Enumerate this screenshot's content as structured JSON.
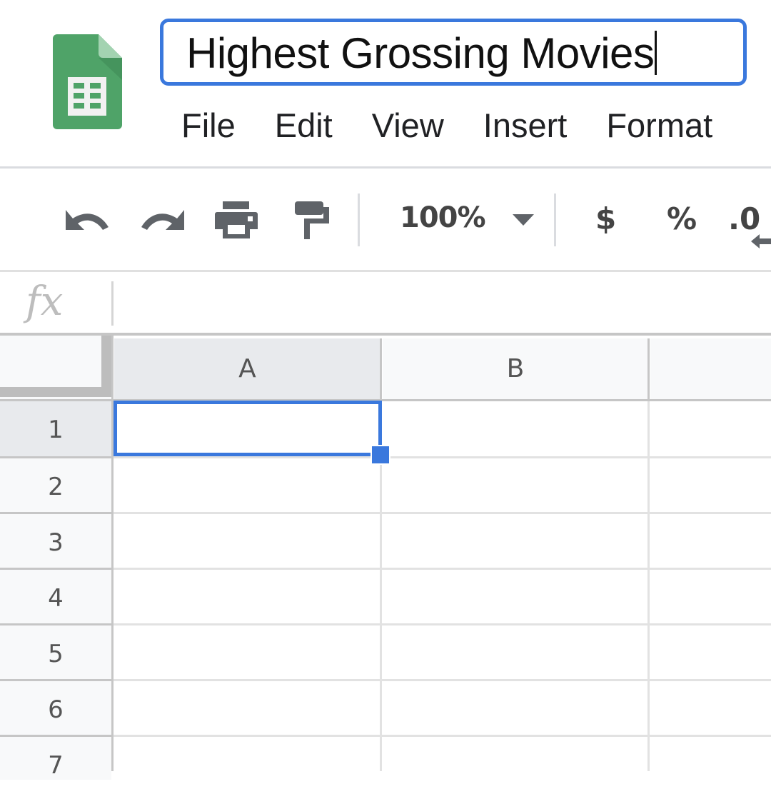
{
  "app": {
    "name": "Google Sheets",
    "logo_icon": "sheets-logo-icon",
    "brand_colors": {
      "green": "#34a853",
      "accent_blue": "#3a78dd"
    }
  },
  "header": {
    "document_title": "Highest Grossing Movies",
    "menu": [
      {
        "label": "File"
      },
      {
        "label": "Edit"
      },
      {
        "label": "View"
      },
      {
        "label": "Insert"
      },
      {
        "label": "Format"
      }
    ]
  },
  "toolbar": {
    "undo_icon": "undo-icon",
    "redo_icon": "redo-icon",
    "print_icon": "print-icon",
    "paint_format_icon": "paint-format-icon",
    "zoom": "100%",
    "zoom_dropdown_icon": "caret-down-icon",
    "currency_label": "$",
    "percent_label": "%",
    "decrease_decimal_label": ".0",
    "decrease_decimal_icon": "arrow-left-icon"
  },
  "formula_bar": {
    "fx_label": "fx",
    "value": ""
  },
  "grid": {
    "columns": [
      "A",
      "B"
    ],
    "rows": [
      "1",
      "2",
      "3",
      "4",
      "5",
      "6",
      "7"
    ],
    "selected_cell": "A1",
    "cells": {
      "A1": "",
      "B1": "",
      "A2": "",
      "B2": "",
      "A3": "",
      "B3": "",
      "A4": "",
      "B4": "",
      "A5": "",
      "B5": "",
      "A6": "",
      "B6": "",
      "A7": "",
      "B7": ""
    }
  }
}
